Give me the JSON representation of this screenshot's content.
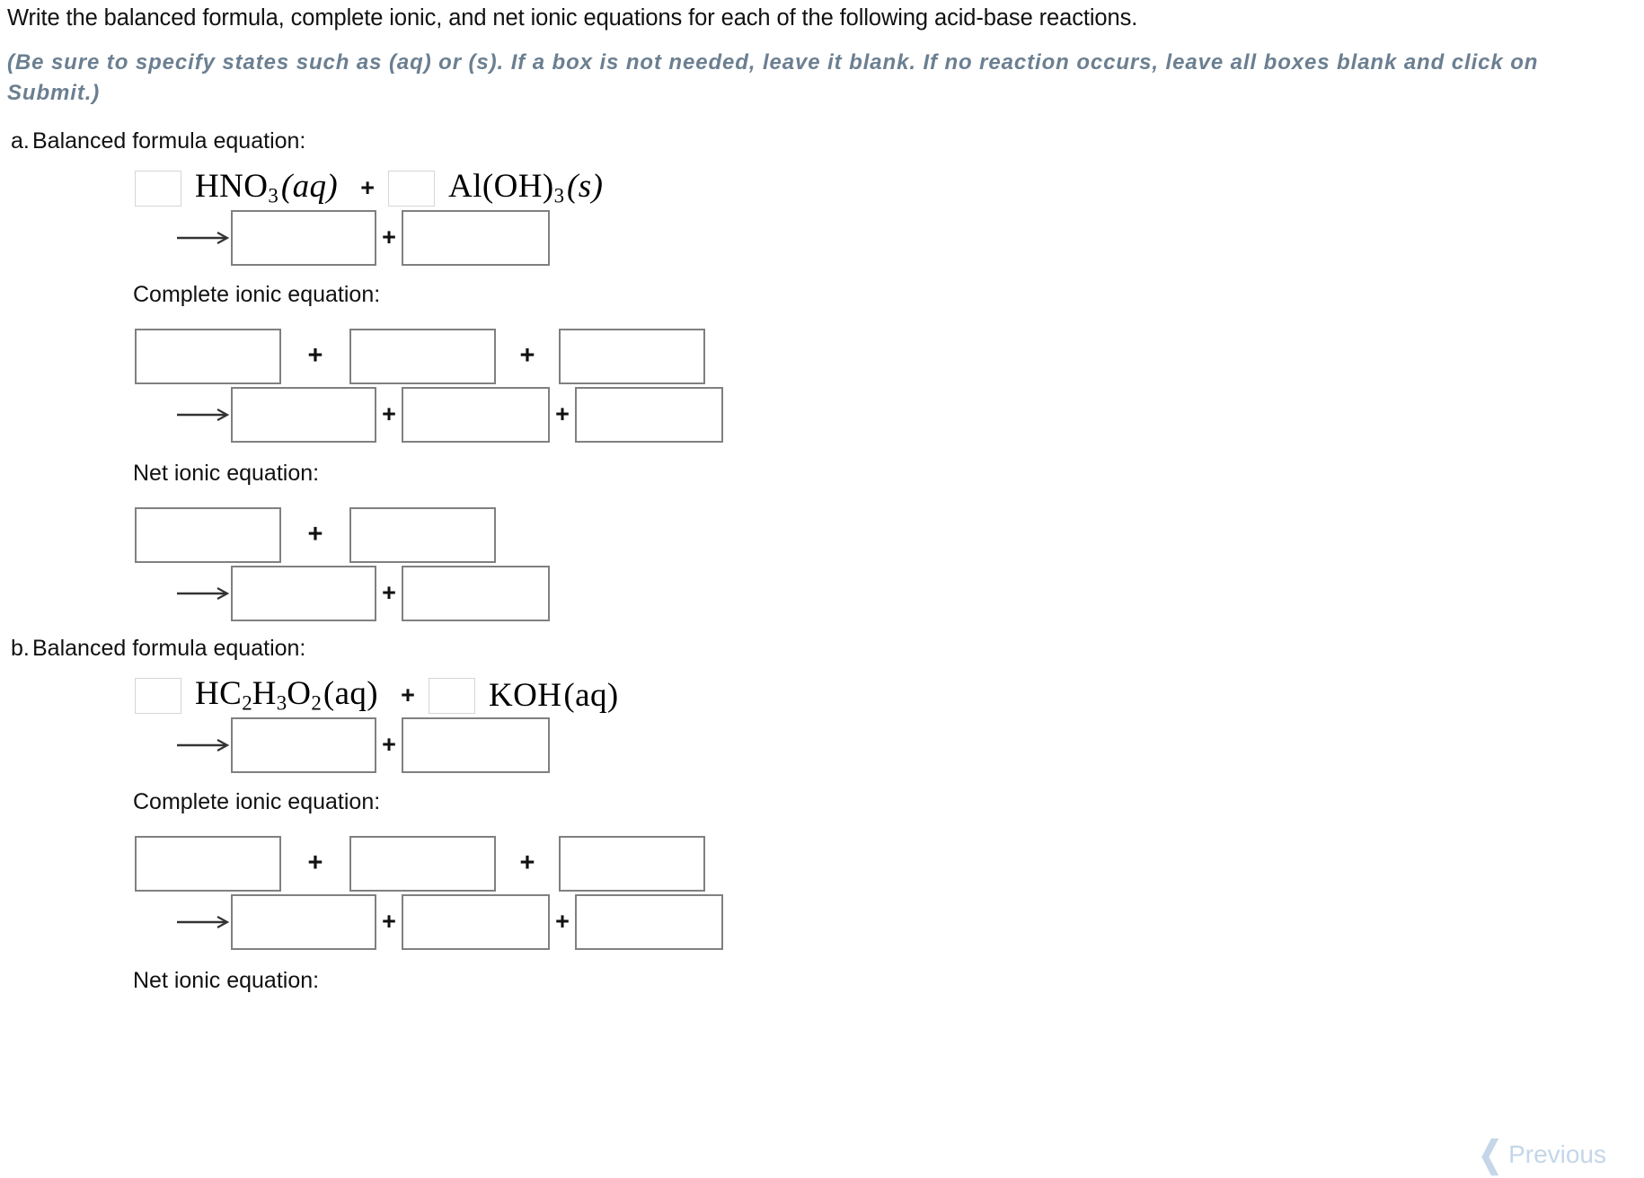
{
  "prompt": {
    "main": "Write the balanced formula, complete ionic, and net ionic equations for each of the following acid-base reactions.",
    "note": "(Be sure to specify states such as (aq) or (s). If a box is not needed, leave it blank. If no reaction occurs, leave all boxes blank and click on Submit.)"
  },
  "labels": {
    "balanced": "Balanced formula equation:",
    "complete_ionic": "Complete ionic equation:",
    "net_ionic": "Net ionic equation:",
    "plus": "+",
    "arrow": "⟶"
  },
  "questions": [
    {
      "letter": "a.",
      "balanced_label": "Balanced formula equation:",
      "reactants": [
        {
          "coefficient": "",
          "formula_html": "HNO",
          "sub": "3",
          "state": "(aq)",
          "state_style": "italic"
        },
        {
          "coefficient": "",
          "formula_html": "Al(OH)",
          "sub": "3",
          "state": "(s)",
          "state_style": "italic"
        }
      ],
      "product_boxes": [
        "",
        ""
      ],
      "complete_ionic_label": "Complete ionic equation:",
      "complete_ionic_reactant_boxes": [
        "",
        "",
        ""
      ],
      "complete_ionic_product_boxes": [
        "",
        "",
        ""
      ],
      "net_ionic_label": "Net ionic equation:",
      "net_ionic_reactant_boxes": [
        "",
        ""
      ],
      "net_ionic_product_boxes": [
        "",
        ""
      ]
    },
    {
      "letter": "b.",
      "balanced_label": "Balanced formula equation:",
      "reactants": [
        {
          "coefficient": "",
          "formula_html": "HC2H3O2",
          "state": "(aq)",
          "state_style": "roman"
        },
        {
          "coefficient": "",
          "formula_html": "KOH",
          "state": "(aq)",
          "state_style": "roman"
        }
      ],
      "product_boxes": [
        "",
        ""
      ],
      "complete_ionic_label": "Complete ionic equation:",
      "complete_ionic_reactant_boxes": [
        "",
        "",
        ""
      ],
      "complete_ionic_product_boxes": [
        "",
        "",
        ""
      ],
      "net_ionic_label": "Net ionic equation:"
    }
  ],
  "footer": {
    "previous_label": "Previous",
    "chevron_icon": "❮"
  },
  "colors": {
    "note_text": "#6b7f91",
    "box_border": "#808080",
    "coef_border": "#d6d6d6",
    "previous": "#c4d6e8"
  }
}
